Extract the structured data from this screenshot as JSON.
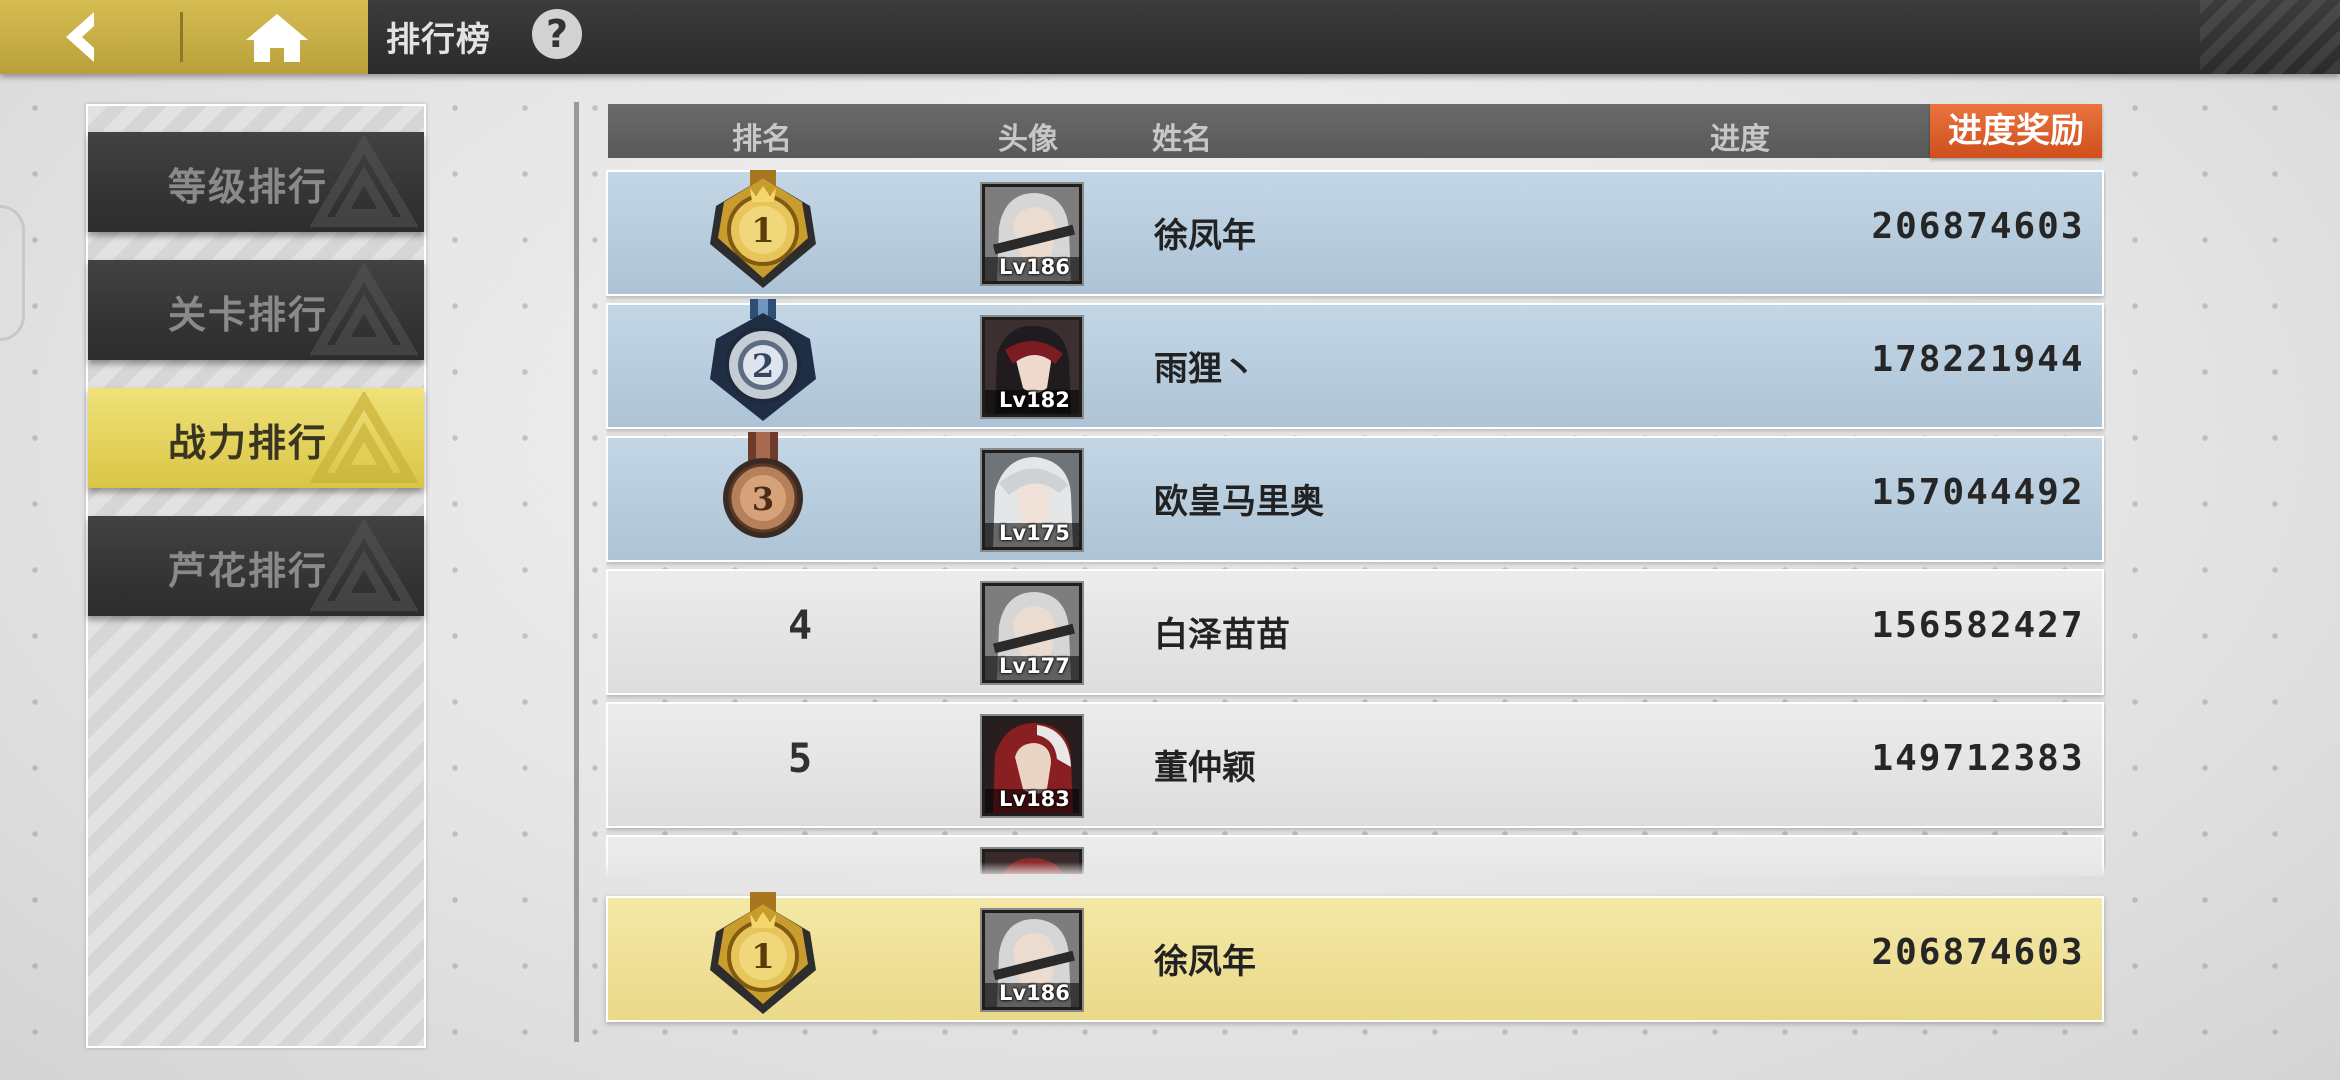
{
  "topbar": {
    "title": "排行榜",
    "help_label": "?"
  },
  "sidebar": {
    "tabs": [
      {
        "label": "等级排行",
        "active": false
      },
      {
        "label": "关卡排行",
        "active": false
      },
      {
        "label": "战力排行",
        "active": true
      },
      {
        "label": "芦花排行",
        "active": false
      }
    ]
  },
  "table": {
    "headers": {
      "rank": "排名",
      "avatar": "头像",
      "name": "姓名",
      "progress": "进度"
    },
    "reward_button": "进度奖励",
    "rows": [
      {
        "rank": "1",
        "medal": "gold",
        "level": "Lv186",
        "name": "徐凤年",
        "score": "206874603"
      },
      {
        "rank": "2",
        "medal": "silver",
        "level": "Lv182",
        "name": "雨狸丶",
        "score": "178221944"
      },
      {
        "rank": "3",
        "medal": "bronze",
        "level": "Lv175",
        "name": "欧皇马里奥",
        "score": "157044492"
      },
      {
        "rank": "4",
        "medal": "",
        "level": "Lv177",
        "name": "白泽苗苗",
        "score": "156582427"
      },
      {
        "rank": "5",
        "medal": "",
        "level": "Lv183",
        "name": "董仲颖",
        "score": "149712383"
      }
    ],
    "my_rank": {
      "rank": "1",
      "medal": "gold",
      "level": "Lv186",
      "name": "徐凤年",
      "score": "206874603"
    }
  },
  "colors": {
    "gold_nav": "#c9b045",
    "active_tab": "#e8d764",
    "top3_row": "#b8cde0",
    "my_row": "#efe19b",
    "reward_button": "#dc5f2a"
  }
}
